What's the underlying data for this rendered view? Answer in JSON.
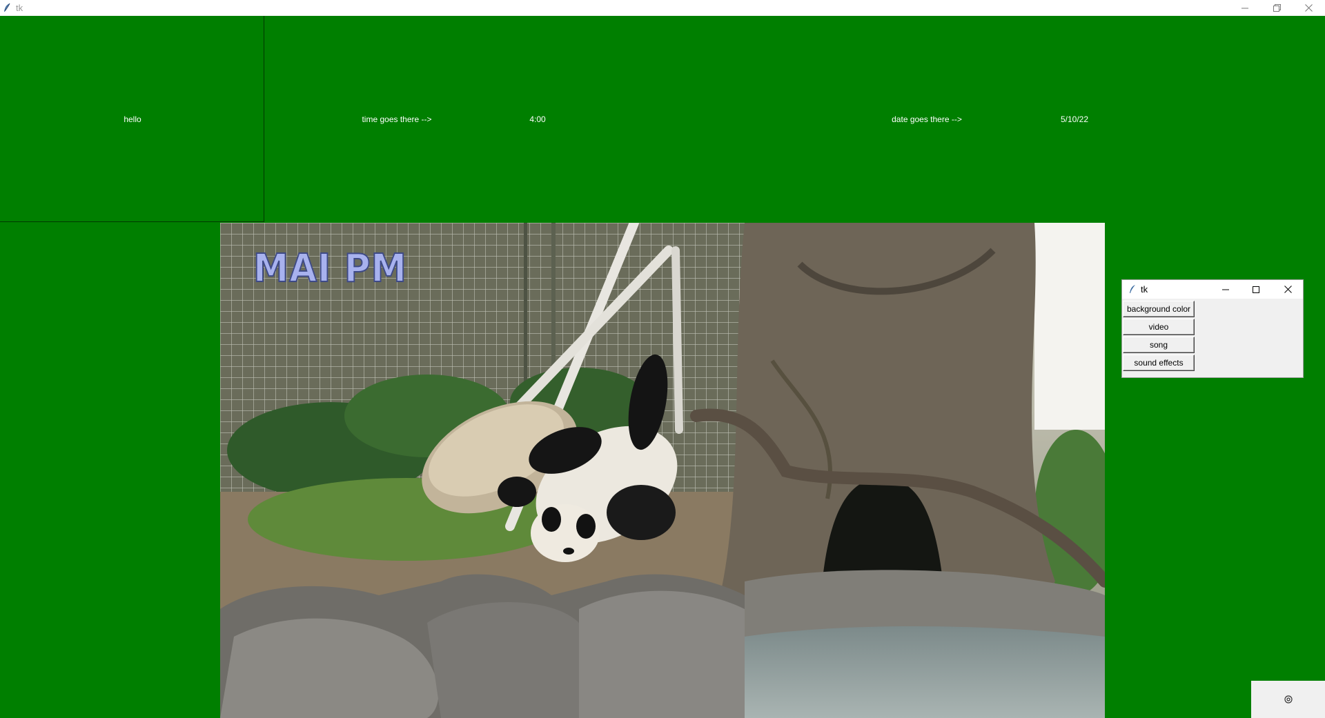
{
  "window": {
    "title": "tk"
  },
  "header": {
    "hello_label": "hello",
    "time_caption": "time goes there -->",
    "time_value": "4:00",
    "date_caption": "date goes there -->",
    "date_value": "5/10/22"
  },
  "video": {
    "overlay_text": "MAI PM"
  },
  "control_window": {
    "title": "tk",
    "buttons": [
      "background color",
      "video",
      "song",
      "sound effects"
    ]
  },
  "colors": {
    "background": "#007f00",
    "text": "#ffffff"
  },
  "icons": {
    "app": "feather-icon",
    "minimize": "minimize-icon",
    "restore": "restore-icon",
    "maximize": "maximize-icon",
    "close": "close-icon",
    "settings": "settings-icon"
  }
}
